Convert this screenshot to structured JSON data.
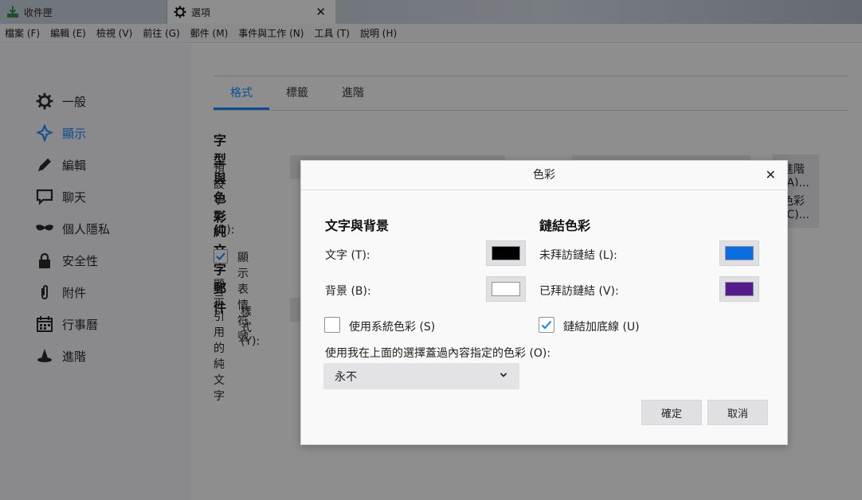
{
  "tabs": [
    {
      "label": "收件匣",
      "icon": "download-icon"
    },
    {
      "label": "選項",
      "icon": "gear-icon"
    }
  ],
  "menubar": [
    "檔案 (F)",
    "編輯 (E)",
    "檢視 (V)",
    "前往 (G)",
    "郵件 (M)",
    "事件與工作 (N)",
    "工具 (T)",
    "說明 (H)"
  ],
  "sidebar": {
    "items": [
      {
        "label": "一般",
        "icon": "gear-icon"
      },
      {
        "label": "顯示",
        "icon": "display-icon"
      },
      {
        "label": "編輯",
        "icon": "pencil-icon"
      },
      {
        "label": "聊天",
        "icon": "chat-icon"
      },
      {
        "label": "個人隱私",
        "icon": "mask-icon"
      },
      {
        "label": "安全性",
        "icon": "lock-icon"
      },
      {
        "label": "附件",
        "icon": "paperclip-icon"
      },
      {
        "label": "行事曆",
        "icon": "calendar-icon"
      },
      {
        "label": "進階",
        "icon": "wizard-icon"
      }
    ]
  },
  "main": {
    "tabs": [
      "格式",
      "標籤",
      "進階"
    ],
    "fonts_heading": "字型與色彩",
    "default_font_label": "預設字型 (D):",
    "advanced_button": "進階 (A)...",
    "colors_button": "色彩 (C)...",
    "plain_text_heading": "純文字郵件",
    "emoticons_label": "顯示表情符號",
    "quoted_label": "顯示引用的純文字",
    "style_label": "樣式 (Y):"
  },
  "dialog": {
    "title": "色彩",
    "text_bg_heading": "文字與背景",
    "text_label": "文字 (T):",
    "text_color": "#000000",
    "background_label": "背景 (B):",
    "background_color": "#ffffff",
    "use_system_colors_label": "使用系統色彩 (S)",
    "use_system_colors_checked": false,
    "link_heading": "鏈結色彩",
    "unvisited_label": "未拜訪鏈結 (L):",
    "unvisited_color": "#0a6ee0",
    "visited_label": "已拜訪鏈結 (V):",
    "visited_color": "#551a8b",
    "underline_label": "鏈結加底線 (U)",
    "underline_checked": true,
    "override_label": "使用我在上面的選擇蓋過內容指定的色彩 (O):",
    "override_value": "永不",
    "ok_label": "確定",
    "cancel_label": "取消"
  }
}
